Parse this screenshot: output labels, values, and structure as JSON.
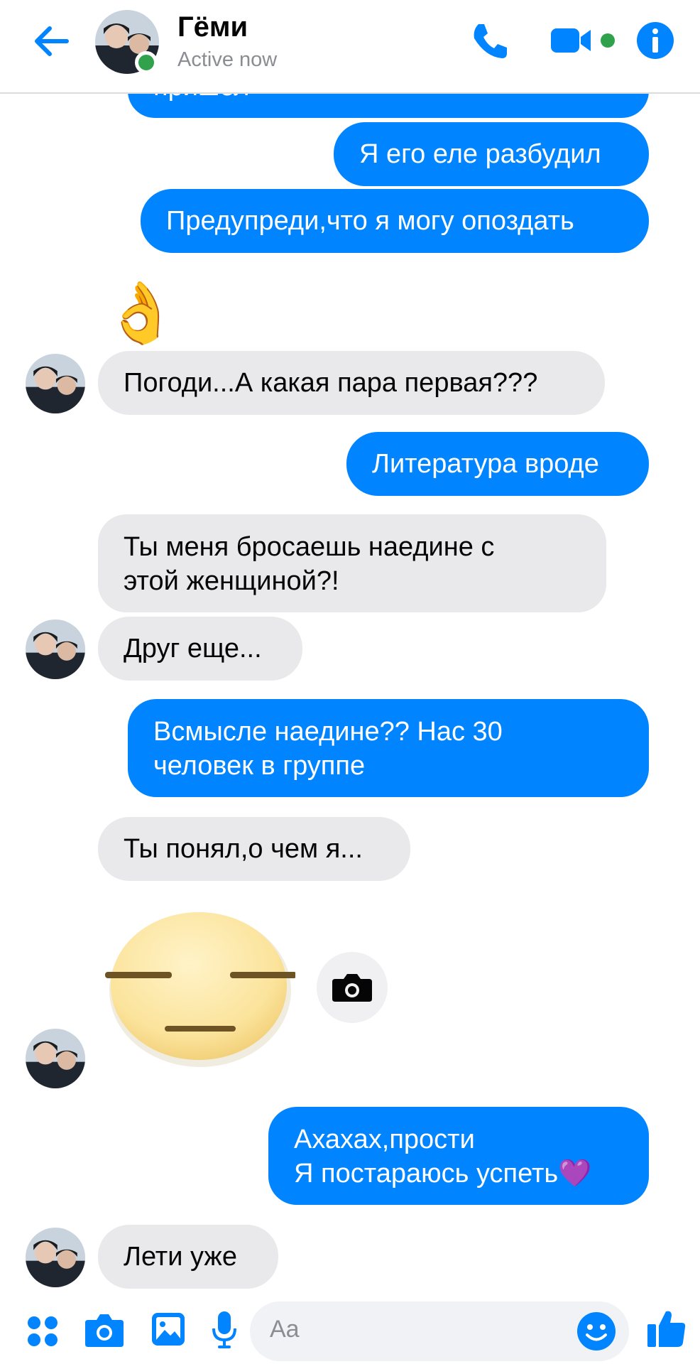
{
  "header": {
    "contact_name": "Гёми",
    "status": "Active now",
    "accent_color": "#0084ff",
    "online_color": "#31a24c"
  },
  "messages": {
    "m0": "пришел",
    "m1": "Я его еле разбудил",
    "m2": "Предупреди,что я могу опоздать",
    "m3": "👌",
    "m4": "Погоди...А какая пара первая???",
    "m5": "Литература вроде",
    "m6_line1": "Ты меня бросаешь наедине с",
    "m6_line2": "этой женщиной?!",
    "m7": "Друг еще...",
    "m8_line1": "Всмысле наедине?? Нас 30",
    "m8_line2": "человек в группе",
    "m9": "Ты понял,о чем я...",
    "m10": "expressionless-face-sticker",
    "m11_line1": "Ахахах,прости",
    "m11_line2": "Я постараюсь успеть💜",
    "m12": "Лети уже"
  },
  "composer": {
    "placeholder": "Aa",
    "icons": [
      "apps-icon",
      "camera-icon",
      "gallery-icon",
      "microphone-icon",
      "emoji-icon",
      "thumbs-up-icon"
    ]
  }
}
